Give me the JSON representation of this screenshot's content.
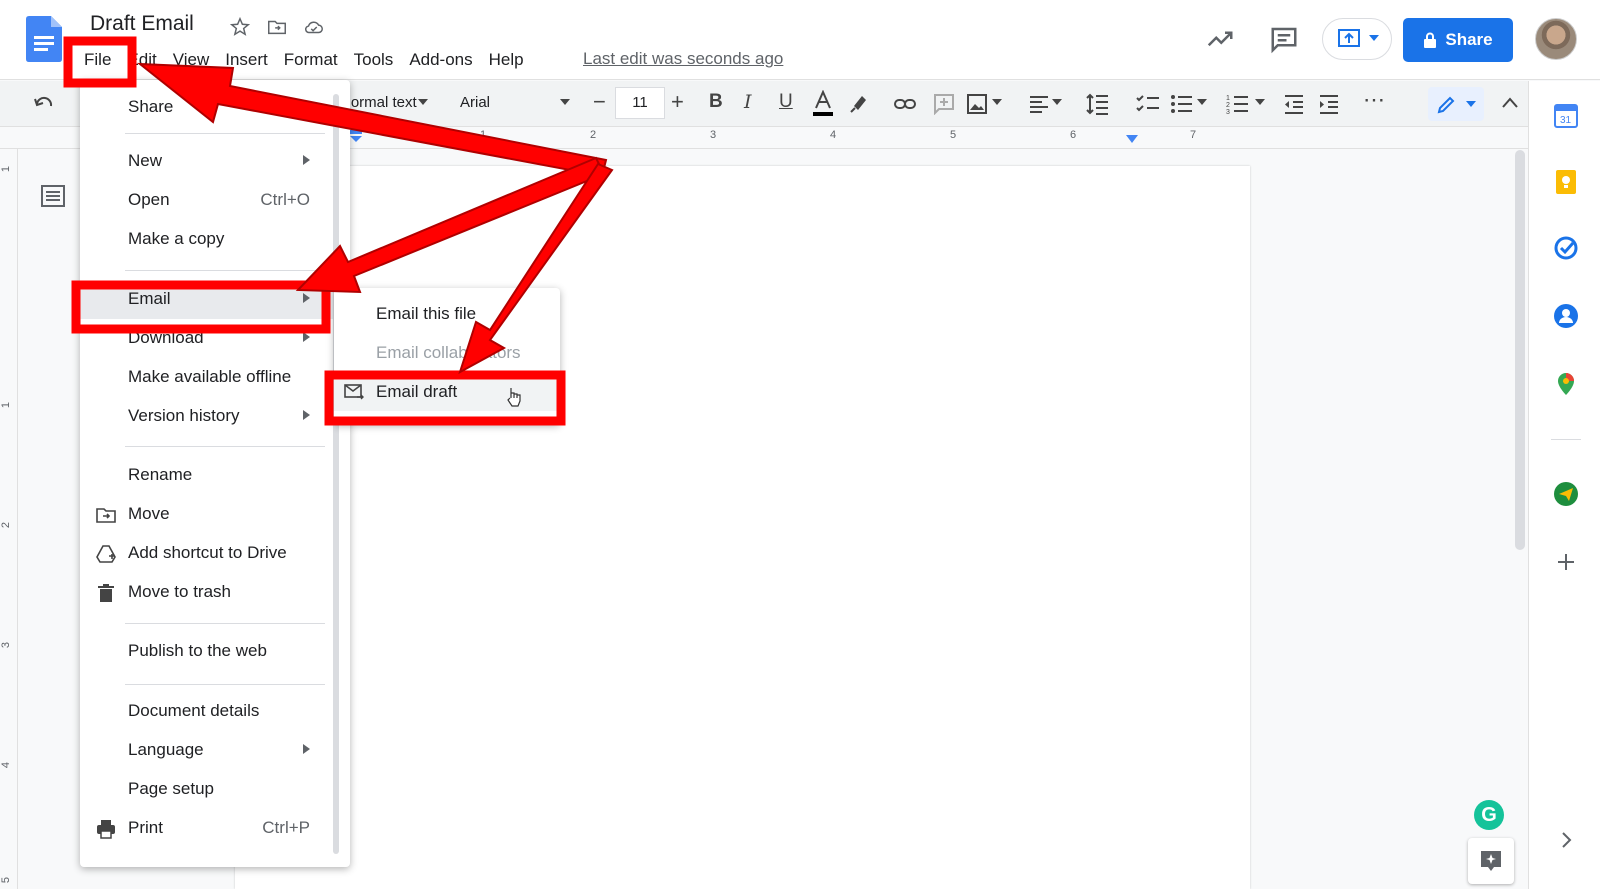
{
  "document": {
    "title": "Draft Email",
    "last_edit": "Last edit was seconds ago"
  },
  "menubar": [
    "File",
    "Edit",
    "View",
    "Insert",
    "Format",
    "Tools",
    "Add-ons",
    "Help"
  ],
  "header": {
    "share_label": "Share"
  },
  "toolbar": {
    "style": "Normal text",
    "font": "Arial",
    "font_size": "11"
  },
  "ruler": {
    "numbers": [
      "1",
      "2",
      "3",
      "4",
      "5",
      "6",
      "7"
    ]
  },
  "vruler": {
    "numbers": [
      "1",
      "1",
      "2",
      "3",
      "4",
      "5"
    ]
  },
  "file_menu": {
    "share": "Share",
    "new": "New",
    "open": "Open",
    "open_shortcut": "Ctrl+O",
    "make_copy": "Make a copy",
    "email": "Email",
    "download": "Download",
    "offline": "Make available offline",
    "version_history": "Version history",
    "rename": "Rename",
    "move": "Move",
    "add_shortcut": "Add shortcut to Drive",
    "trash": "Move to trash",
    "publish": "Publish to the web",
    "details": "Document details",
    "language": "Language",
    "page_setup": "Page setup",
    "print": "Print",
    "print_shortcut": "Ctrl+P"
  },
  "email_submenu": {
    "email_file": "Email this file",
    "email_collaborators": "Email collaborators",
    "email_draft": "Email draft"
  },
  "colors": {
    "accent": "#1a73e8",
    "annotation": "#ff0000",
    "grammarly": "#15c39a"
  }
}
